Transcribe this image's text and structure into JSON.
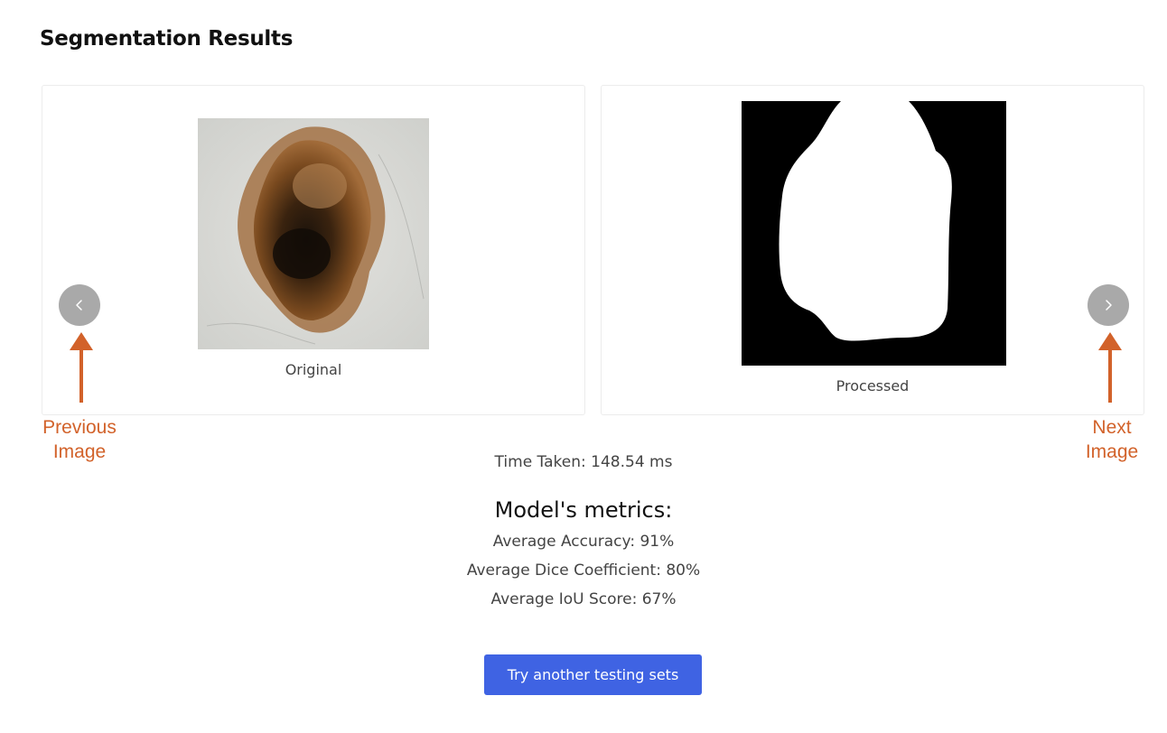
{
  "header": {
    "title": "Segmentation Results"
  },
  "original": {
    "caption": "Original"
  },
  "processed": {
    "caption": "Processed"
  },
  "annotations": {
    "previous": "Previous\nImage",
    "next": "Next\nImage",
    "color": "#d2622a"
  },
  "stats": {
    "time_taken": "Time Taken: 148.54 ms"
  },
  "metrics": {
    "title": "Model's metrics:",
    "accuracy": "Average Accuracy: 91%",
    "dice": "Average Dice Coefficient: 80%",
    "iou": "Average IoU Score: 67%"
  },
  "actions": {
    "try_another": "Try another testing sets"
  },
  "colors": {
    "accent": "#3f63e3",
    "nav_button": "#a9a9a9"
  },
  "icons": {
    "prev": "chevron-left-icon",
    "next": "chevron-right-icon"
  }
}
